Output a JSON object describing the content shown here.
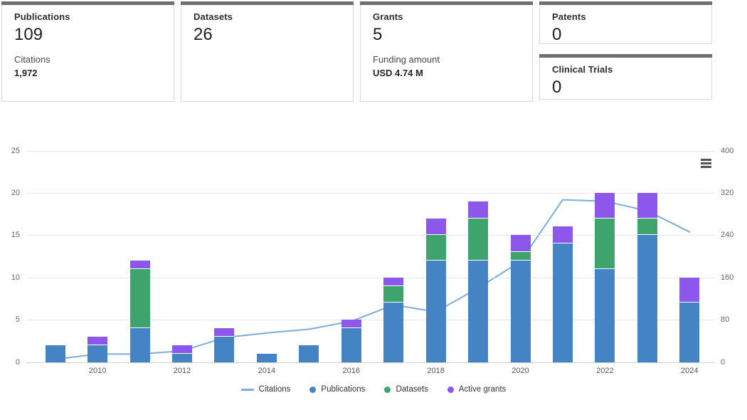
{
  "cards": [
    {
      "title": "Publications",
      "value": "109",
      "sub_label": "Citations",
      "sub_value": "1,972"
    },
    {
      "title": "Datasets",
      "value": "26",
      "sub_label": "",
      "sub_value": ""
    },
    {
      "title": "Grants",
      "value": "5",
      "sub_label": "Funding amount",
      "sub_value": "USD 4.74 M"
    },
    {
      "title": "Patents",
      "value": "0"
    },
    {
      "title": "Clinical Trials",
      "value": "0"
    }
  ],
  "icons": {
    "context_menu": "hamburger-icon"
  },
  "colors": {
    "publications": "#4584c4",
    "datasets": "#3ea36d",
    "active_grants": "#8c57ea",
    "citations_line": "#7cacdc",
    "card_strip": "#6f6f6f"
  },
  "chart_data": {
    "type": "bar",
    "subtype": "stacked-columns-with-line-overlay",
    "title": "",
    "grid": true,
    "legend_position": "bottom",
    "x": [
      2009,
      2010,
      2011,
      2012,
      2013,
      2014,
      2015,
      2016,
      2017,
      2018,
      2019,
      2020,
      2021,
      2022,
      2023,
      2024
    ],
    "x_tick_labels": [
      "2010",
      "2012",
      "2014",
      "2016",
      "2018",
      "2020",
      "2022",
      "2024"
    ],
    "left_axis": {
      "ticks": [
        0,
        5,
        10,
        15,
        20,
        25
      ],
      "min": 0,
      "max": 25
    },
    "right_axis": {
      "ticks": [
        0,
        80,
        160,
        240,
        320,
        400
      ],
      "min": 0,
      "max": 400
    },
    "series": [
      {
        "name": "Publications",
        "type": "column",
        "axis": "left",
        "color": "#4584c4",
        "values": [
          2,
          2,
          4,
          1,
          3,
          1,
          2,
          4,
          7,
          12,
          12,
          12,
          14,
          11,
          15,
          7
        ]
      },
      {
        "name": "Datasets",
        "type": "column",
        "axis": "left",
        "color": "#3ea36d",
        "values": [
          0,
          0,
          7,
          0,
          0,
          0,
          0,
          0,
          2,
          3,
          5,
          1,
          0,
          6,
          2,
          0
        ]
      },
      {
        "name": "Active grants",
        "type": "column",
        "axis": "left",
        "color": "#8c57ea",
        "values": [
          0,
          1,
          1,
          1,
          1,
          0,
          0,
          1,
          1,
          2,
          2,
          2,
          2,
          3,
          3,
          3
        ]
      },
      {
        "name": "Citations",
        "type": "line",
        "axis": "right",
        "color": "#7cacdc",
        "values": [
          5,
          15,
          15,
          21,
          46,
          55,
          62,
          77,
          108,
          95,
          140,
          190,
          307,
          304,
          286,
          246
        ]
      }
    ],
    "legend": [
      {
        "label": "Citations",
        "marker": "line",
        "color": "#7cacdc"
      },
      {
        "label": "Publications",
        "marker": "circle",
        "color": "#4584c4"
      },
      {
        "label": "Datasets",
        "marker": "circle",
        "color": "#3ea36d"
      },
      {
        "label": "Active grants",
        "marker": "circle",
        "color": "#8c57ea"
      }
    ]
  }
}
